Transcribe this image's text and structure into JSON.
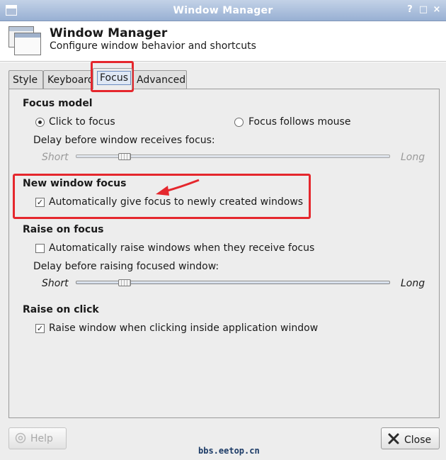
{
  "window": {
    "title": "Window Manager",
    "controls": {
      "help": "?",
      "maximize": "□",
      "close": "×"
    }
  },
  "header": {
    "title": "Window Manager",
    "subtitle": "Configure window behavior and shortcuts"
  },
  "tabs": [
    {
      "label": "Style",
      "active": false
    },
    {
      "label": "Keyboard",
      "active": false
    },
    {
      "label": "Focus",
      "active": true
    },
    {
      "label": "Advanced",
      "active": false
    }
  ],
  "focus_model": {
    "heading": "Focus model",
    "click_to_focus": {
      "label": "Click to focus",
      "selected": true
    },
    "focus_follows_mouse": {
      "label": "Focus follows mouse",
      "selected": false
    },
    "delay_label": "Delay before window receives focus:",
    "slider_min": "Short",
    "slider_max": "Long",
    "slider_value": 0.14,
    "slider_enabled": false
  },
  "new_window_focus": {
    "heading": "New window focus",
    "auto_focus": {
      "label": "Automatically give focus to newly created windows",
      "checked": true
    }
  },
  "raise_on_focus": {
    "heading": "Raise on focus",
    "auto_raise": {
      "label": "Automatically raise windows when they receive focus",
      "checked": false
    },
    "delay_label": "Delay before raising focused window:",
    "slider_min": "Short",
    "slider_max": "Long",
    "slider_value": 0.14,
    "slider_enabled": true
  },
  "raise_on_click": {
    "heading": "Raise on click",
    "raise_click": {
      "label": "Raise window when clicking inside application window",
      "checked": true
    }
  },
  "buttons": {
    "help": {
      "label": "Help",
      "enabled": false
    },
    "close": {
      "label": "Close",
      "enabled": true
    }
  },
  "watermark": "bbs.eetop.cn",
  "annotations": {
    "highlight_color": "#e5272d"
  },
  "icons": [
    "window-icon",
    "app-icon",
    "help-icon",
    "close-icon",
    "arrow-icon"
  ]
}
